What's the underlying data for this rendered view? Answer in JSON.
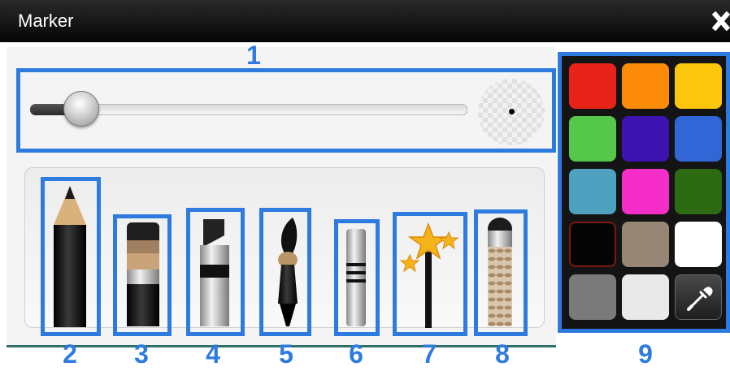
{
  "window": {
    "title": "Marker"
  },
  "callout_numbers": [
    "1",
    "2",
    "3",
    "4",
    "5",
    "6",
    "7",
    "8",
    "9"
  ],
  "tools": [
    {
      "icon": "pencil-icon"
    },
    {
      "icon": "marker-pen-icon"
    },
    {
      "icon": "highlighter-icon"
    },
    {
      "icon": "brush-icon"
    },
    {
      "icon": "line-pen-icon"
    },
    {
      "icon": "star-wand-icon"
    },
    {
      "icon": "eraser-pen-icon"
    }
  ],
  "palette": {
    "colors": [
      "#e8241a",
      "#fb8b08",
      "#fcc60c",
      "#55c74b",
      "#3d13b2",
      "#3166d7",
      "#4fa1c0",
      "#f52ec9",
      "#2d6a12",
      "#050505",
      "#958675",
      "#ffffff",
      "#7a7a7a",
      "#e9e9e9"
    ],
    "selected": "#050505",
    "eyedropper": "eyedropper-icon"
  },
  "accent": "#2e7be0"
}
